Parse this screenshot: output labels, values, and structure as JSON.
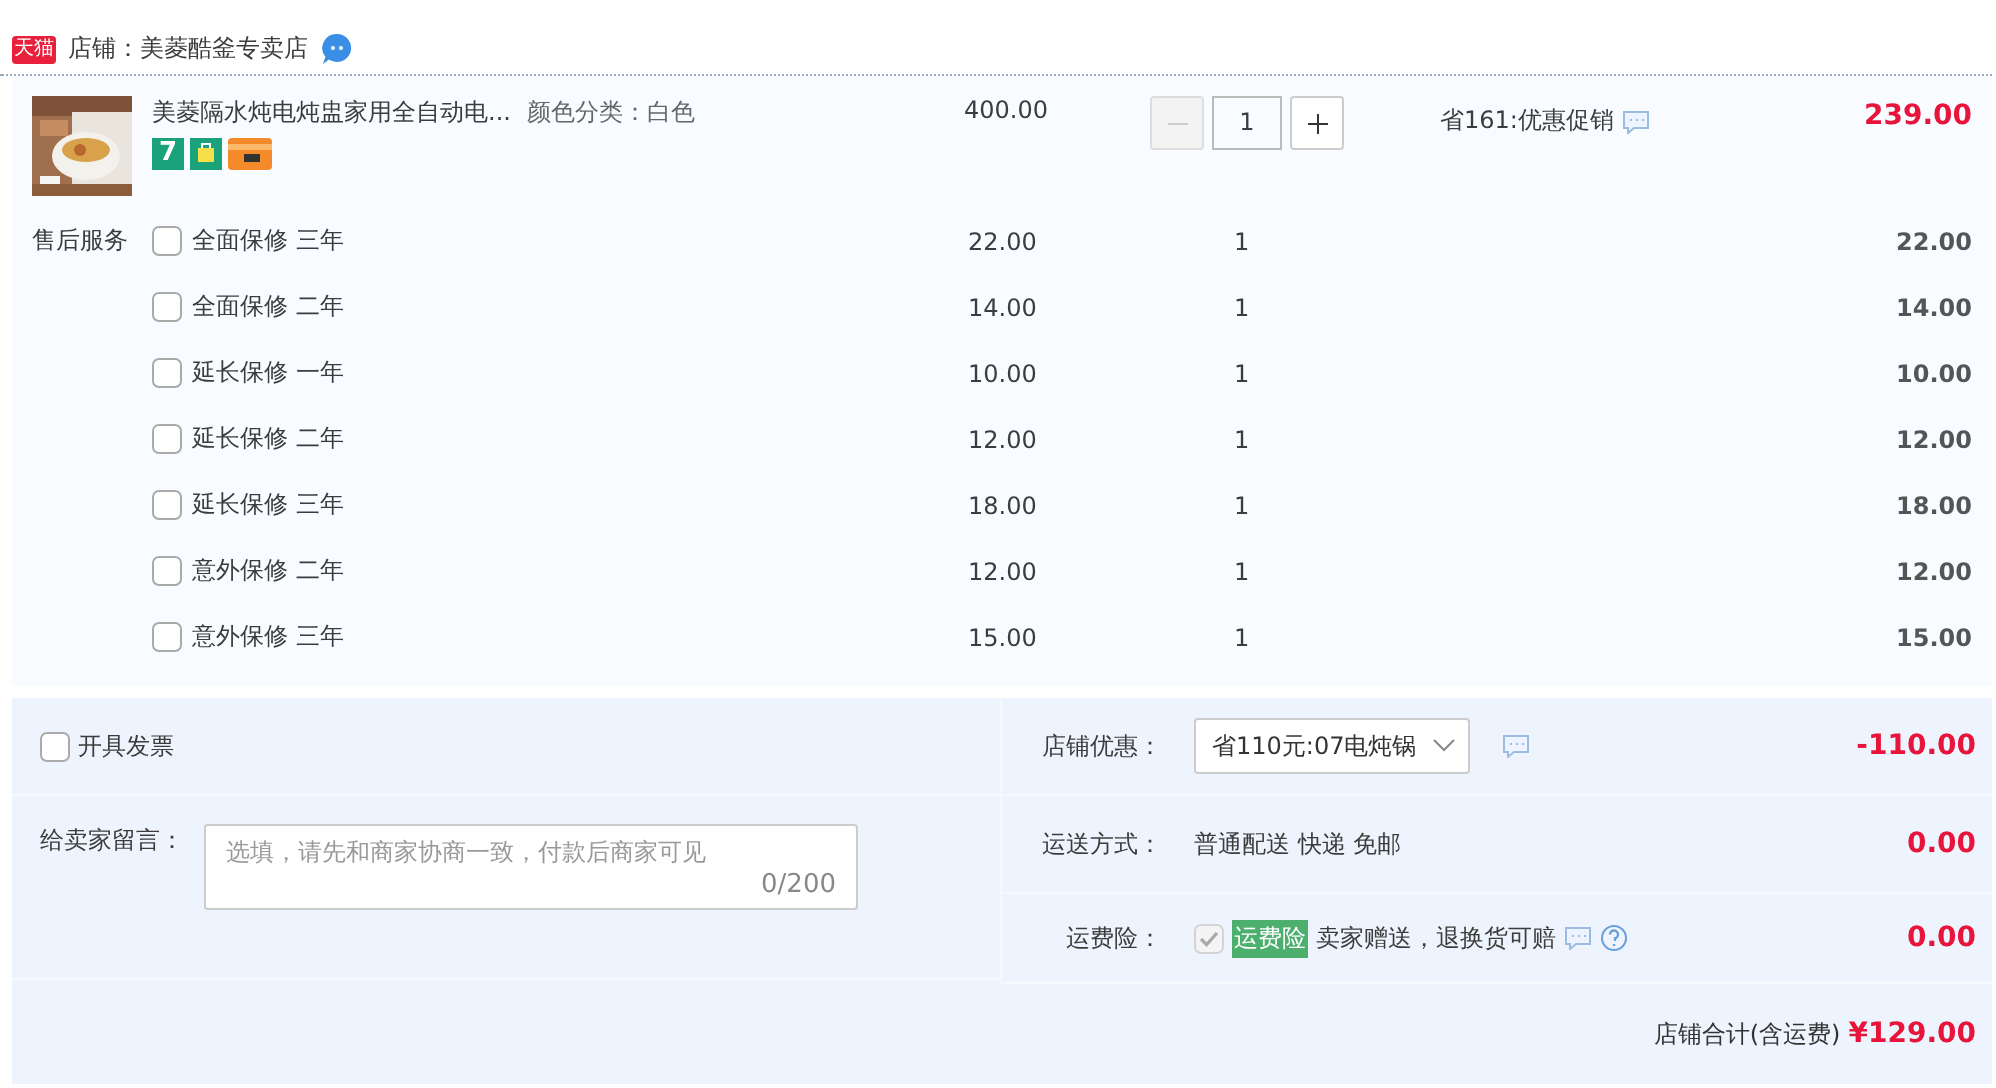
{
  "store": {
    "badge": "天猫",
    "name": "店铺：美菱酷釜专卖店"
  },
  "item": {
    "title": "美菱隔水炖电炖盅家用全自动电...",
    "sku": "颜色分类：白色",
    "badge": "7",
    "price": "400.00",
    "quantity": "1",
    "decrement_disabled": true,
    "promo": "省161:优惠促销",
    "total": "239.00"
  },
  "services": {
    "label": "售后服务",
    "options": [
      {
        "name": "全面保修 三年",
        "checked": false,
        "price": "22.00",
        "quantity": "1",
        "total": "22.00"
      },
      {
        "name": "全面保修 二年",
        "checked": false,
        "price": "14.00",
        "quantity": "1",
        "total": "14.00"
      },
      {
        "name": "延长保修 一年",
        "checked": false,
        "price": "10.00",
        "quantity": "1",
        "total": "10.00"
      },
      {
        "name": "延长保修 二年",
        "checked": false,
        "price": "12.00",
        "quantity": "1",
        "total": "12.00"
      },
      {
        "name": "延长保修 三年",
        "checked": false,
        "price": "18.00",
        "quantity": "1",
        "total": "18.00"
      },
      {
        "name": "意外保修 二年",
        "checked": false,
        "price": "12.00",
        "quantity": "1",
        "total": "12.00"
      },
      {
        "name": "意外保修 三年",
        "checked": false,
        "price": "15.00",
        "quantity": "1",
        "total": "15.00"
      }
    ]
  },
  "invoice": {
    "label": "开具发票",
    "checked": false
  },
  "message": {
    "label": "给卖家留言：",
    "placeholder": "选填，请先和商家协商一致，付款后商家可见",
    "counter": "0/200"
  },
  "coupon": {
    "label": "店铺优惠：",
    "value": "省110元:07电炖锅",
    "amount": "-110.00"
  },
  "shipping": {
    "label": "运送方式：",
    "value": "普通配送 快递 免邮",
    "amount": "0.00"
  },
  "insurance": {
    "label": "运费险：",
    "checked": true,
    "disabled": true,
    "tag": "运费险",
    "text": "卖家赠送，退换货可赔",
    "amount": "0.00"
  },
  "total": {
    "label": "店铺合计(含运费)",
    "amount": "¥129.00"
  }
}
